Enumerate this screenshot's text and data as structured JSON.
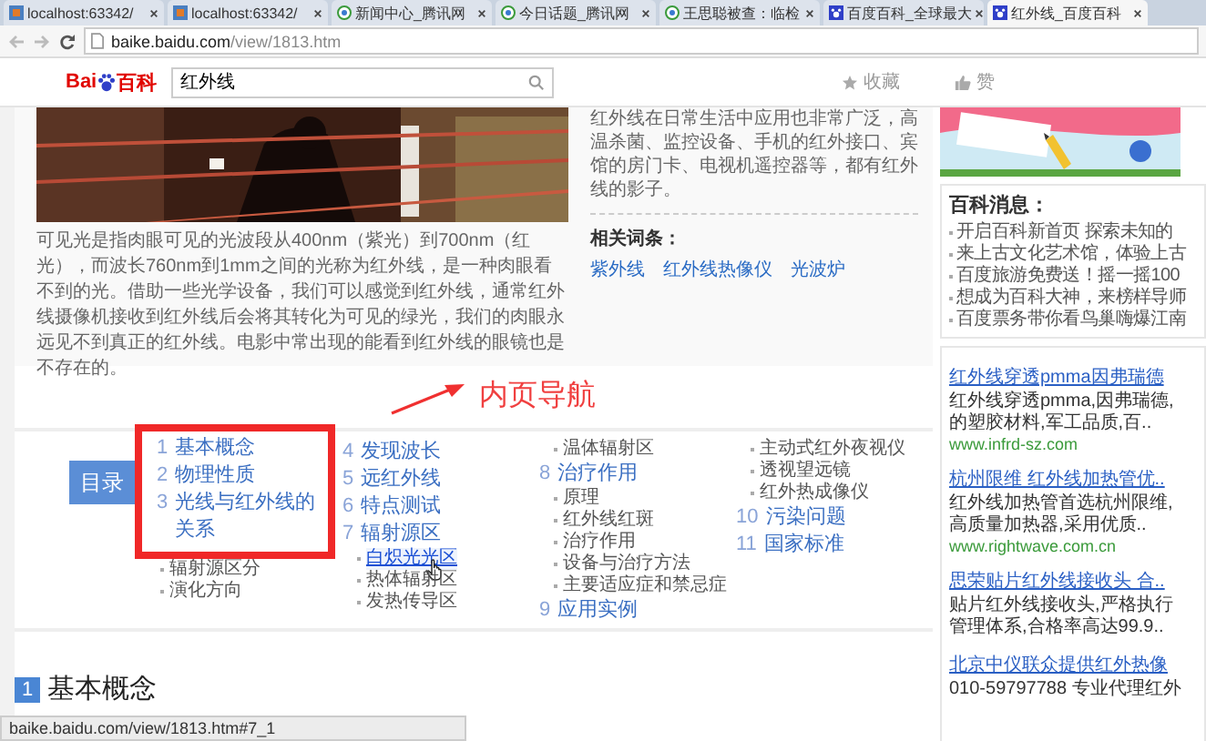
{
  "browser": {
    "tabs": [
      {
        "label": "localhost:63342/",
        "kind": "local",
        "selected": false
      },
      {
        "label": "localhost:63342/",
        "kind": "local",
        "selected": false
      },
      {
        "label": "新闻中心_腾讯网",
        "kind": "news",
        "selected": false
      },
      {
        "label": "今日话题_腾讯网",
        "kind": "news",
        "selected": false
      },
      {
        "label": "王思聪被查：临检",
        "kind": "news",
        "selected": false
      },
      {
        "label": "百度百科_全球最大",
        "kind": "baike",
        "selected": false
      },
      {
        "label": "红外线_百度百科",
        "kind": "baike",
        "selected": true
      }
    ],
    "address": {
      "domain": "baike.baidu.com",
      "path": "/view/1813.htm"
    },
    "status_url": "baike.baidu.com/view/1813.htm#7_1"
  },
  "header": {
    "logo": {
      "latin": "Bai",
      "cjk": "百科"
    },
    "search": {
      "value": "红外线"
    },
    "actions": [
      {
        "kind": "star",
        "label": "收藏"
      },
      {
        "kind": "like",
        "label": "赞"
      }
    ]
  },
  "article": {
    "summary": "可见光是指肉眼可见的光波段从400nm（紫光）到700nm（红光），而波长760nm到1mm之间的光称为红外线，是一种肉眼看不到的光。借助一些光学设备，我们可以感觉到红外线，通常红外线摄像机接收到红外线后会将其转化为可见的绿光，我们的肉眼永远见不到真正的红外线。电影中常出现的能看到红外线的眼镜也是不存在的。",
    "side_text": "红外线在日常生活中应用也非常广泛，高温杀菌、监控设备、手机的红外接口、宾馆的房门卡、电视机遥控器等，都有红外线的影子。",
    "related": {
      "title": "相关词条：",
      "links": [
        "紫外线",
        "红外线热像仪",
        "光波炉"
      ]
    }
  },
  "annotation": {
    "label": "内页导航"
  },
  "toc": {
    "title": "目录",
    "columns": [
      [
        {
          "kind": "section",
          "number": "1",
          "title": "基本概念",
          "boxed": true
        },
        {
          "kind": "section",
          "number": "2",
          "title": "物理性质",
          "boxed": true
        },
        {
          "kind": "section",
          "number": "3",
          "title": "光线与红外线的关系",
          "boxed": true
        },
        {
          "kind": "sub",
          "title": "辐射源区分",
          "boxed": false,
          "hovered": false
        },
        {
          "kind": "sub",
          "title": "演化方向",
          "boxed": false,
          "hovered": false
        }
      ],
      [
        {
          "kind": "section",
          "number": "4",
          "title": "发现波长",
          "boxed": false
        },
        {
          "kind": "section",
          "number": "5",
          "title": "远红外线",
          "boxed": false
        },
        {
          "kind": "section",
          "number": "6",
          "title": "特点测试",
          "boxed": false
        },
        {
          "kind": "section",
          "number": "7",
          "title": "辐射源区",
          "boxed": false
        },
        {
          "kind": "sub",
          "title": "白炽光光区",
          "boxed": false,
          "hovered": true
        },
        {
          "kind": "sub",
          "title": "热体辐射区",
          "boxed": false,
          "hovered": false
        },
        {
          "kind": "sub",
          "title": "发热传导区",
          "boxed": false,
          "hovered": false
        }
      ],
      [
        {
          "kind": "sub",
          "title": "温体辐射区",
          "boxed": false,
          "hovered": false
        },
        {
          "kind": "section",
          "number": "8",
          "title": "治疗作用",
          "boxed": false
        },
        {
          "kind": "sub",
          "title": "原理",
          "boxed": false,
          "hovered": false
        },
        {
          "kind": "sub",
          "title": "红外线红斑",
          "boxed": false,
          "hovered": false
        },
        {
          "kind": "sub",
          "title": "治疗作用",
          "boxed": false,
          "hovered": false
        },
        {
          "kind": "sub",
          "title": "设备与治疗方法",
          "boxed": false,
          "hovered": false
        },
        {
          "kind": "sub",
          "title": "主要适应症和禁忌症",
          "boxed": false,
          "hovered": false
        },
        {
          "kind": "section",
          "number": "9",
          "title": "应用实例",
          "boxed": false
        }
      ],
      [
        {
          "kind": "sub",
          "title": "主动式红外夜视仪",
          "boxed": false,
          "hovered": false
        },
        {
          "kind": "sub",
          "title": "透视望远镜",
          "boxed": false,
          "hovered": false
        },
        {
          "kind": "sub",
          "title": "红外热成像仪",
          "boxed": false,
          "hovered": false
        },
        {
          "kind": "section",
          "number": "10",
          "title": "污染问题",
          "boxed": false
        },
        {
          "kind": "section",
          "number": "11",
          "title": "国家标准",
          "boxed": false
        }
      ]
    ]
  },
  "section_heading": {
    "number": "1",
    "title": "基本概念"
  },
  "sidebar": {
    "news": {
      "title": "百科消息：",
      "items": [
        "开启百科新首页 探索未知的",
        "来上古文化艺术馆，体验上古",
        "百度旅游免费送！摇一摇100",
        "想成为百科大神，来榜样导师",
        "百度票务带你看鸟巢嗨爆江南"
      ]
    },
    "ads": [
      {
        "title": "红外线穿透pmma因弗瑞德",
        "lines": [
          "红外线穿透pmma,因弗瑞德,",
          "的塑胶材料,军工品质,百.."
        ],
        "url": "www.infrd-sz.com"
      },
      {
        "title": "杭州限维 红外线加热管优..",
        "lines": [
          "红外线加热管首选杭州限维,",
          "高质量加热器,采用优质.."
        ],
        "url": "www.rightwave.com.cn"
      },
      {
        "title": "思荣贴片红外线接收头 合..",
        "lines": [
          "贴片红外线接收头,严格执行",
          "管理体系,合格率高达99.9.."
        ]
      },
      {
        "title": "北京中仪联众提供红外热像",
        "lines": [
          "010-59797788 专业代理红外"
        ]
      }
    ]
  }
}
